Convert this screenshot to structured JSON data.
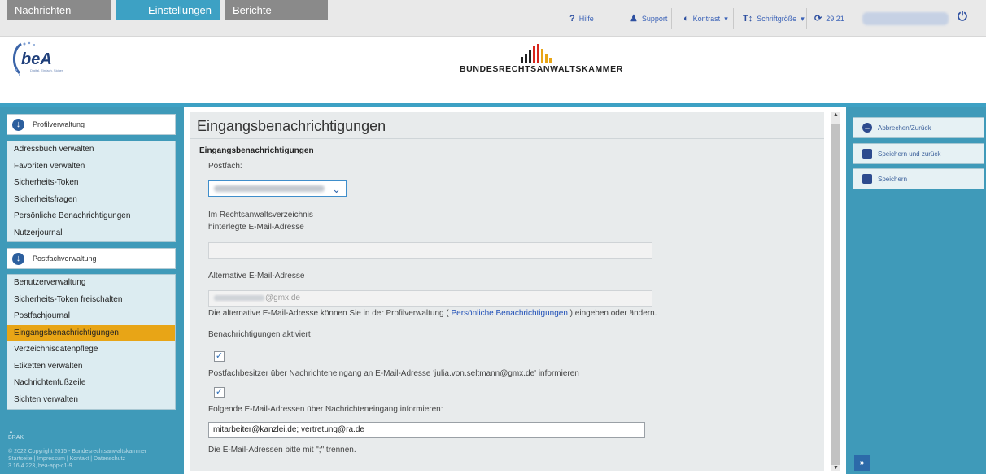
{
  "topbar": {
    "help": "Hilfe",
    "support": "Support",
    "contrast": "Kontrast",
    "font_size": "Schriftgröße",
    "session_timer": "29:21",
    "icons": [
      "help-icon",
      "support-icon",
      "contrast-icon",
      "font-size-icon",
      "refresh-icon",
      "power-icon"
    ]
  },
  "header": {
    "app_logo": "beA",
    "app_logo_sub": "Digital. Einfach. Sicher.",
    "chamber_name": "BUNDESRECHTSANWALTSKAMMER"
  },
  "nav": {
    "tabs": [
      {
        "label": "Nachrichten"
      },
      {
        "label": "Einstellungen"
      },
      {
        "label": "Berichte"
      }
    ]
  },
  "sidebar": {
    "groups": [
      {
        "title": "Profilverwaltung",
        "items": [
          {
            "label": "Adressbuch verwalten"
          },
          {
            "label": "Favoriten verwalten"
          },
          {
            "label": "Sicherheits-Token"
          },
          {
            "label": "Sicherheitsfragen"
          },
          {
            "label": "Persönliche Benachrichtigungen"
          },
          {
            "label": "Nutzerjournal"
          }
        ]
      },
      {
        "title": "Postfachverwaltung",
        "items": [
          {
            "label": "Benutzerverwaltung"
          },
          {
            "label": "Sicherheits-Token freischalten"
          },
          {
            "label": "Postfachjournal"
          },
          {
            "label": "Eingangsbenachrichtigungen",
            "active": true
          },
          {
            "label": "Verzeichnisdatenpflege"
          },
          {
            "label": "Etiketten verwalten"
          },
          {
            "label": "Nachrichtenfußzeile"
          },
          {
            "label": "Sichten verwalten"
          }
        ]
      }
    ],
    "footer_logo": "BRAK",
    "copyright": "© 2022 Copyright 2015 - Bundesrechtsanwaltskammer",
    "footer_links": "Startseite | Impressum | Kontakt | Datenschutz",
    "version": "3.16.4.223, bea-app-c1-9"
  },
  "main": {
    "title": "Eingangsbenachrichtigungen",
    "section_title": "Eingangsbenachrichtigungen",
    "mailbox_label": "Postfach:",
    "registry_email_label_1": "Im Rechtsanwaltsverzeichnis",
    "registry_email_label_2": "hinterlegte E-Mail-Adresse",
    "registry_email_value": "",
    "alt_email_label": "Alternative E-Mail-Adresse",
    "alt_email_value": "@gmx.de",
    "alt_email_hint_before": "Die alternative E-Mail-Adresse können Sie in der Profilverwaltung ( ",
    "alt_email_hint_link": "Persönliche Benachrichtigungen",
    "alt_email_hint_after": " ) eingeben oder ändern.",
    "notifications_label": "Benachrichtigungen aktiviert",
    "checkbox1_checked": true,
    "owner_notify_text": "Postfachbesitzer über Nachrichteneingang an E-Mail-Adresse 'julia.von.seltmann@gmx.de' informieren",
    "checkbox2_checked": true,
    "recipients_label": "Folgende E-Mail-Adressen über Nachrichteneingang informieren:",
    "recipients_value": "mitarbeiter@kanzlei.de; vertretung@ra.de",
    "recipients_hint": "Die E-Mail-Adressen bitte mit \";\" trennen.",
    "check_glyph": "✓"
  },
  "actions": {
    "back": "Abbrechen/Zurück",
    "save_back": "Speichern und zurück",
    "save": "Speichern",
    "expand": "»"
  }
}
